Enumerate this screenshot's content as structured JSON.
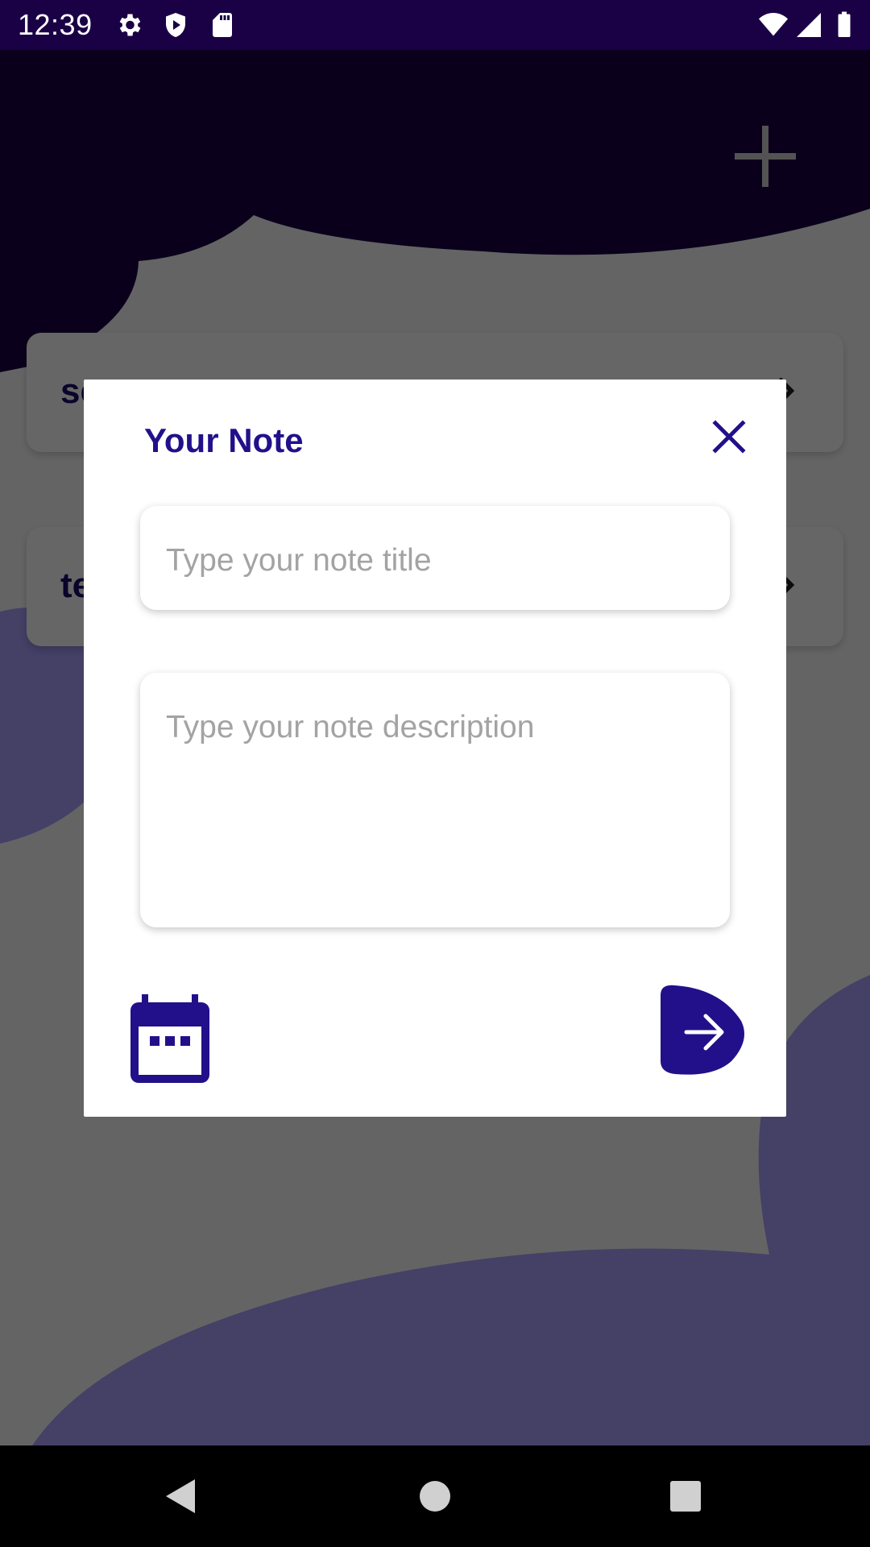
{
  "status_bar": {
    "time": "12:39",
    "left_icons": [
      "gear-icon",
      "shield-play-icon",
      "sd-card-icon"
    ],
    "right_icons": [
      "wifi-icon",
      "signal-icon",
      "battery-icon"
    ]
  },
  "background": {
    "header_color": "#1a0045",
    "accent_color": "#aaa0ff",
    "add_icon": "plus-icon",
    "notes": [
      {
        "title": "se",
        "icon": "chevron-right-icon"
      },
      {
        "title": "te",
        "icon": "chevron-right-icon"
      }
    ]
  },
  "dialog": {
    "title": "Your Note",
    "close_icon": "close-icon",
    "title_placeholder": "Type your note title",
    "description_placeholder": "Type your note description",
    "calendar_icon": "calendar-icon",
    "submit_icon": "arrow-right-icon",
    "accent_color": "#22108a"
  },
  "nav_bar": {
    "icons": [
      "back-icon",
      "home-icon",
      "recents-icon"
    ]
  }
}
